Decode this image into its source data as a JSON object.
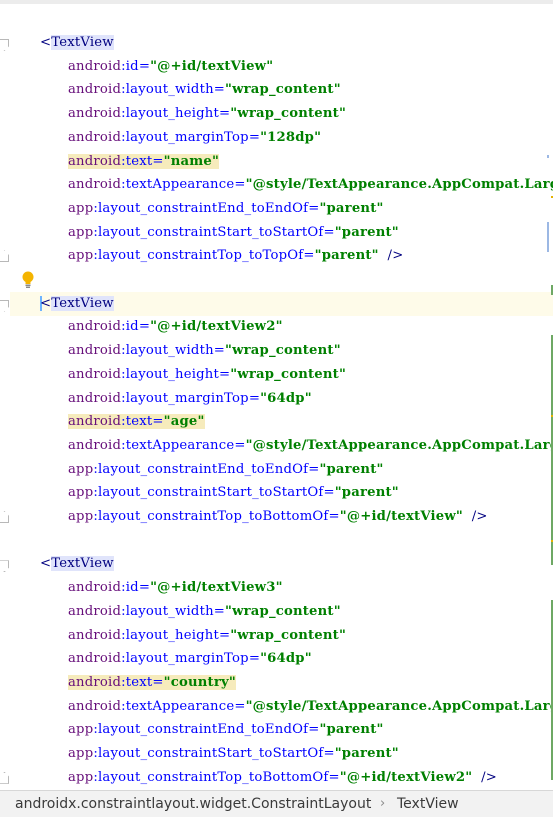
{
  "editor": {
    "blocks": [
      {
        "tag": "TextView",
        "attrs": [
          {
            "ns": "android",
            "name": "id",
            "value": "\"@+id/textView\""
          },
          {
            "ns": "android",
            "name": "layout_width",
            "value": "\"wrap_content\""
          },
          {
            "ns": "android",
            "name": "layout_height",
            "value": "\"wrap_content\""
          },
          {
            "ns": "android",
            "name": "layout_marginTop",
            "value": "\"128dp\""
          },
          {
            "ns": "android",
            "name": "text",
            "value": "\"name\""
          },
          {
            "ns": "android",
            "name": "textAppearance",
            "value": "\"@style/TextAppearance.AppCompat.Large\""
          },
          {
            "ns": "app",
            "name": "layout_constraintEnd_toEndOf",
            "value": "\"parent\""
          },
          {
            "ns": "app",
            "name": "layout_constraintStart_toStartOf",
            "value": "\"parent\""
          },
          {
            "ns": "app",
            "name": "layout_constraintTop_toTopOf",
            "value": "\"parent\""
          }
        ]
      },
      {
        "tag": "TextView",
        "attrs": [
          {
            "ns": "android",
            "name": "id",
            "value": "\"@+id/textView2\""
          },
          {
            "ns": "android",
            "name": "layout_width",
            "value": "\"wrap_content\""
          },
          {
            "ns": "android",
            "name": "layout_height",
            "value": "\"wrap_content\""
          },
          {
            "ns": "android",
            "name": "layout_marginTop",
            "value": "\"64dp\""
          },
          {
            "ns": "android",
            "name": "text",
            "value": "\"age\""
          },
          {
            "ns": "android",
            "name": "textAppearance",
            "value": "\"@style/TextAppearance.AppCompat.Large\""
          },
          {
            "ns": "app",
            "name": "layout_constraintEnd_toEndOf",
            "value": "\"parent\""
          },
          {
            "ns": "app",
            "name": "layout_constraintStart_toStartOf",
            "value": "\"parent\""
          },
          {
            "ns": "app",
            "name": "layout_constraintTop_toBottomOf",
            "value": "\"@+id/textView\""
          }
        ]
      },
      {
        "tag": "TextView",
        "attrs": [
          {
            "ns": "android",
            "name": "id",
            "value": "\"@+id/textView3\""
          },
          {
            "ns": "android",
            "name": "layout_width",
            "value": "\"wrap_content\""
          },
          {
            "ns": "android",
            "name": "layout_height",
            "value": "\"wrap_content\""
          },
          {
            "ns": "android",
            "name": "layout_marginTop",
            "value": "\"64dp\""
          },
          {
            "ns": "android",
            "name": "text",
            "value": "\"country\""
          },
          {
            "ns": "android",
            "name": "textAppearance",
            "value": "\"@style/TextAppearance.AppCompat.Large\""
          },
          {
            "ns": "app",
            "name": "layout_constraintEnd_toEndOf",
            "value": "\"parent\""
          },
          {
            "ns": "app",
            "name": "layout_constraintStart_toStartOf",
            "value": "\"parent\""
          },
          {
            "ns": "app",
            "name": "layout_constraintTop_toBottomOf",
            "value": "\"@+id/textView2\""
          }
        ]
      }
    ],
    "tag_open": "<",
    "tag_close": "/>",
    "colors": {
      "tag": "#000080",
      "namespace": "#660e7a",
      "attribute": "#0000ff",
      "value": "#008000",
      "caret_line": "#fefbe9",
      "text_attr_highlight": "#f6ebbc"
    },
    "intention_icon": "lightbulb-icon"
  },
  "statusbar": {
    "breadcrumbs": [
      "androidx.constraintlayout.widget.ConstraintLayout",
      "TextView"
    ],
    "separator": "›"
  }
}
